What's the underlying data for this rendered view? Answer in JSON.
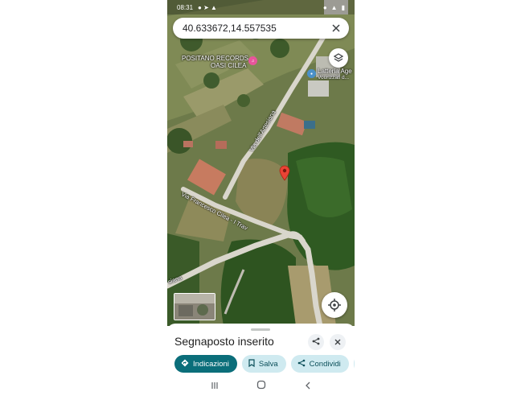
{
  "status_bar": {
    "time": "08:31"
  },
  "search": {
    "value": "40.633672,14.557535",
    "clear_icon": "close-icon"
  },
  "map": {
    "labels": {
      "poi_1_line1": "POSITANO RECORDS",
      "poi_1_line2": "OASI CILEA",
      "poi_2_line1": "Latteria Age",
      "poi_2_line2": "Vourizzati d...",
      "road_1": "Via dell'Artesiana",
      "road_2": "Via Francesco Cilea - I Trav",
      "road_3": "siana"
    },
    "pin_color": "#ea4335",
    "poi_pink": "#e8559b",
    "poi_blue": "#4a90c8"
  },
  "sheet": {
    "title": "Segnaposto inserito",
    "chips": {
      "directions": "Indicazioni",
      "save": "Salva",
      "share": "Condividi"
    }
  },
  "colors": {
    "primary": "#0b6e7a",
    "secondary_bg": "#cfeaf0"
  }
}
